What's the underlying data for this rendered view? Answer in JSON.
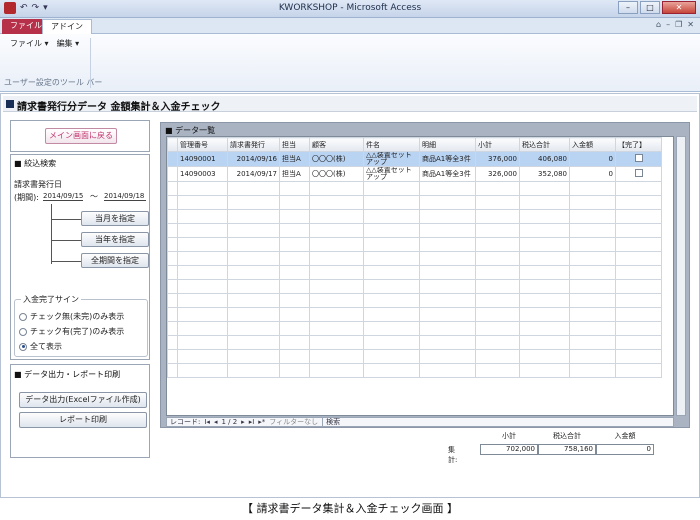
{
  "window": {
    "title": "KWORKSHOP - Microsoft Access",
    "controls": [
      "–",
      "□",
      "✕"
    ]
  },
  "ribbon": {
    "tabs": [
      "ファイル",
      "アドイン"
    ],
    "menu": [
      "ファイル ▾",
      "編集 ▾"
    ],
    "group_label": "ユーザー設定のツール バー",
    "right_icons": [
      "⌂",
      "–",
      "❐",
      "✕"
    ]
  },
  "form": {
    "title": "請求書発行分データ 金額集計＆入金チェック",
    "back_button": "メイン画面に戻る",
    "filter": {
      "heading": "■ 絞込検索",
      "label": "請求書発行日",
      "period_label": "(期間):",
      "date_from": "2014/09/15",
      "tilde": "～",
      "date_to": "2014/09/18",
      "btn_month": "当月を指定",
      "btn_year": "当年を指定",
      "btn_all": "全期間を指定"
    },
    "complete_sign": {
      "heading": "入金完了サイン",
      "options": [
        "チェック無(未完)のみ表示",
        "チェック有(完了)のみ表示",
        "全て表示"
      ],
      "selected": 2
    },
    "output": {
      "heading": "■ データ出力・レポート印刷",
      "btn_excel": "データ出力(Excelファイル作成)",
      "btn_report": "レポート印刷"
    },
    "datasheet": {
      "label": "■ データ一覧",
      "columns": [
        "管理番号",
        "請求書発行",
        "担当",
        "顧客",
        "件名",
        "明細",
        "小計",
        "税込合計",
        "入金額",
        "【完了】"
      ],
      "rows": [
        [
          "14090001",
          "2014/09/16",
          "担当A",
          "〇〇〇(株)",
          "△△装置セットアップ",
          "商品A1等全3件",
          "376,000",
          "406,080",
          "0"
        ],
        [
          "14090003",
          "2014/09/17",
          "担当A",
          "〇〇〇(株)",
          "△△装置セットアップ",
          "商品A1等全3件",
          "326,000",
          "352,080",
          "0"
        ]
      ],
      "nav": {
        "record_label": "レコード:",
        "first": "I◂",
        "prev": "◂",
        "position": "1 / 2",
        "next": "▸",
        "last": "▸I",
        "new": "▸*",
        "filter": "フィルターなし",
        "search": "検索"
      }
    },
    "totals": {
      "label": "集計:",
      "headers": [
        "小計",
        "税込合計",
        "入金額"
      ],
      "values": [
        "702,000",
        "758,160",
        "0"
      ]
    }
  },
  "caption": "【 請求書データ集計＆入金チェック画面 】"
}
